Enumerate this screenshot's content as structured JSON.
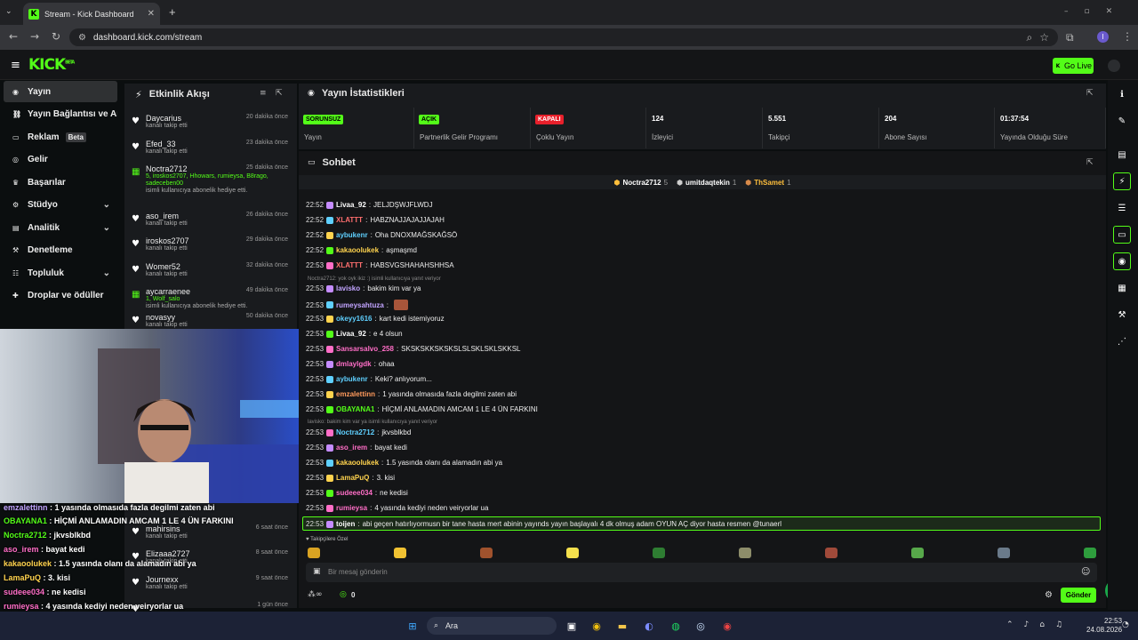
{
  "browser": {
    "tab_title": "Stream - Kick Dashboard",
    "url": "dashboard.kick.com/stream",
    "profile": "I"
  },
  "header": {
    "logo": "KICK",
    "logo_sup": "BETA",
    "go_live": "Go Live"
  },
  "nav": [
    {
      "label": "Yayın",
      "icon": "signal-icon"
    },
    {
      "label": "Yayın Bağlantısı ve Anahtarı",
      "icon": "link-icon"
    },
    {
      "label": "Reklam",
      "icon": "tv-icon",
      "badge": "Beta"
    },
    {
      "label": "Gelir",
      "icon": "coin-icon"
    },
    {
      "label": "Başarılar",
      "icon": "trophy-icon"
    },
    {
      "label": "Stüdyo",
      "icon": "settings-icon"
    },
    {
      "label": "Analitik",
      "icon": "chart-icon"
    },
    {
      "label": "Denetleme",
      "icon": "gavel-icon"
    },
    {
      "label": "Topluluk",
      "icon": "people-icon"
    },
    {
      "label": "Droplar ve ödüller",
      "icon": "gift-icon"
    }
  ],
  "activity": {
    "title": "Etkinlik Akışı",
    "items": [
      {
        "user": "Daycarius",
        "action": "kanalı takip etti",
        "time": "20 dakika önce"
      },
      {
        "user": "Efed_33",
        "action": "kanalı takip etti",
        "time": "23 dakika önce"
      },
      {
        "user": "Noctra2712",
        "action": "isimli kullanıcıya abonelik hediye etti.",
        "time": "25 dakika önce",
        "subs": "5, iroskos2707, Hhowars, rumieysa, B8rago, sadeceben00"
      },
      {
        "user": "aso_irem",
        "action": "kanalı takip etti",
        "time": "26 dakika önce"
      },
      {
        "user": "iroskos2707",
        "action": "kanalı takip etti",
        "time": "29 dakika önce"
      },
      {
        "user": "Womer52",
        "action": "kanalı takip etti",
        "time": "32 dakika önce"
      },
      {
        "user": "aycarraenee",
        "action": "isimli kullanıcıya abonelik hediye etti.",
        "time": "49 dakika önce",
        "subs": "1, Wolf_salo"
      },
      {
        "user": "novasyy",
        "action": "kanalı takip etti",
        "time": "50 dakika önce"
      },
      {
        "user": "mahirsins",
        "action": "kanalı takip etti",
        "time": "6 saat önce"
      },
      {
        "user": "Elizaaa2727",
        "action": "kanalı takip etti",
        "time": "8 saat önce"
      },
      {
        "user": "Journexx",
        "action": "kanalı takip etti",
        "time": "9 saat önce"
      },
      {
        "user": "",
        "action": "",
        "time": "1 gün önce"
      }
    ]
  },
  "overlay": [
    {
      "user": "emzalettinn",
      "msg": "1 yasında olmasıda fazla degilmi zaten abi",
      "color": "#c2a4ff"
    },
    {
      "user": "OBAYANA1",
      "msg": "HİÇMİ ANLAMADIN AMCAM 1 LE 4 ÜN FARKINI",
      "color": "#53fc18"
    },
    {
      "user": "Noctra2712",
      "msg": "jkvsblkbd",
      "color": "#53fc18"
    },
    {
      "user": "aso_irem",
      "msg": "bayat kedi",
      "color": "#ff6ec7"
    },
    {
      "user": "kakaoolukek",
      "msg": "1.5 yasında olanı da alamadın abi ya",
      "color": "#ffd34e"
    },
    {
      "user": "LamaPuQ",
      "msg": "3. kisi",
      "color": "#ffd34e"
    },
    {
      "user": "sudeee034",
      "msg": "ne kedisi",
      "color": "#ff6ec7"
    },
    {
      "user": "rumieysa",
      "msg": "4 yasında kediyi neden veiryorlar ua",
      "color": "#ff6ec7"
    },
    {
      "user": "toijen",
      "msg": "abi geçen hatırlıyormusn bir tane hasta mert abinin yayınds yayın başlayalı 4 dk olmuş adam OYUN AÇ diyor hasta resmen",
      "mention": "@tunaerl"
    }
  ],
  "stats": {
    "title": "Yayın İstatistikleri",
    "items": [
      {
        "value": "SORUNSUZ",
        "label": "Yayın",
        "pill": "#53fc18"
      },
      {
        "value": "AÇIK",
        "label": "Partnerlik Gelir Programı",
        "pill": "#53fc18"
      },
      {
        "value": "KAPALI",
        "label": "Çoklu Yayın",
        "pill": "#e8202b"
      },
      {
        "value": "124",
        "label": "İzleyici"
      },
      {
        "value": "5.551",
        "label": "Takipçi"
      },
      {
        "value": "204",
        "label": "Abone Sayısı"
      },
      {
        "value": "01:37:54",
        "label": "Yayında Olduğu Süre"
      }
    ]
  },
  "chat": {
    "title": "Sohbet",
    "top": [
      {
        "name": "Noctra2712",
        "n": "5"
      },
      {
        "name": "umitdaqtekin",
        "n": "1"
      },
      {
        "name": "ThSamet",
        "n": "1"
      }
    ],
    "lines": [
      {
        "t": "22:52",
        "u": "Livaa_92",
        "m": "JELJDŞWJFLWDJ",
        "c": "#ffffff"
      },
      {
        "t": "22:52",
        "u": "XLATTT",
        "m": "HABZNAJJAJAJJAJAH",
        "c": "#ff6e6e"
      },
      {
        "t": "22:52",
        "u": "aybukenr",
        "m": "Oha DNOXMAĞSKAĞSÖ",
        "c": "#5fd0ff"
      },
      {
        "t": "22:52",
        "u": "kakaoolukek",
        "m": "aşmaşmd",
        "c": "#ffd34e"
      },
      {
        "t": "22:53",
        "u": "XLATTT",
        "m": "HABSVGSHAHAHSHHSA",
        "c": "#ff6e6e"
      },
      {
        "t": "22:53",
        "u": "lavisko",
        "m": "bakim kim var ya",
        "c": "#c2a4ff"
      },
      {
        "t": "22:53",
        "u": "rumeysahtuza",
        "m": "",
        "c": "#c2a4ff"
      },
      {
        "t": "22:53",
        "u": "okeyy1616",
        "m": "kart kedi istemiyoruz",
        "c": "#5fd0ff"
      },
      {
        "t": "22:53",
        "u": "Livaa_92",
        "m": "e 4 olsun",
        "c": "#ffffff"
      },
      {
        "t": "22:53",
        "u": "Sansarsalvo_258",
        "m": "SKSKSKKSKSKSLSLSKLSKLSKKSL",
        "c": "#ff6ec7"
      },
      {
        "t": "22:53",
        "u": "dmlaylgdk",
        "m": "ohaa",
        "c": "#ff6ec7"
      },
      {
        "t": "22:53",
        "u": "aybukenr",
        "m": "Keki? anlıyorum...",
        "c": "#5fd0ff"
      },
      {
        "t": "22:53",
        "u": "emzalettinn",
        "m": "1 yasında olmasıda fazla degilmi zaten abi",
        "c": "#ff9a5c"
      },
      {
        "t": "22:53",
        "u": "OBAYANA1",
        "m": "HİÇMİ ANLAMADIN AMCAM 1 LE 4 ÜN FARKINI",
        "c": "#53fc18"
      },
      {
        "t": "22:53",
        "u": "Noctra2712",
        "m": "jkvsblkbd",
        "c": "#5fd0ff"
      },
      {
        "t": "22:53",
        "u": "aso_irem",
        "m": "bayat kedi",
        "c": "#ff6ec7"
      },
      {
        "t": "22:53",
        "u": "kakaoolukek",
        "m": "1.5 yasında olanı da alamadın abi ya",
        "c": "#ffd34e"
      },
      {
        "t": "22:53",
        "u": "LamaPuQ",
        "m": "3. kisi",
        "c": "#ffd34e"
      },
      {
        "t": "22:53",
        "u": "sudeee034",
        "m": "ne kedisi",
        "c": "#ff6ec7"
      },
      {
        "t": "22:53",
        "u": "rumieysa",
        "m": "4 yasında kediyi neden veiryorlar ua",
        "c": "#ff6ec7"
      },
      {
        "t": "22:53",
        "u": "toijen",
        "m": "abi geçen hatırlıyormusn bir tane hasta mert abinin yayınds yayın başlayalı 4 dk olmuş adam OYUN AÇ diyor hasta resmen @tunaerl",
        "c": "#ffffff"
      }
    ],
    "replies": [
      "Noctra2712: yok oyk ikiz :) isimli kullanıcıya yanıt veriyor",
      "lavisko: bakim kim var ya isimli kullanıcıya yanıt veriyor"
    ],
    "emote_tab": "Takipçilere Özel",
    "placeholder": "Bir mesaj gönderin",
    "send": "Gönder",
    "points": "0"
  },
  "taskbar": {
    "search": "Ara",
    "time": "22:53",
    "date": "24.08.2026"
  }
}
